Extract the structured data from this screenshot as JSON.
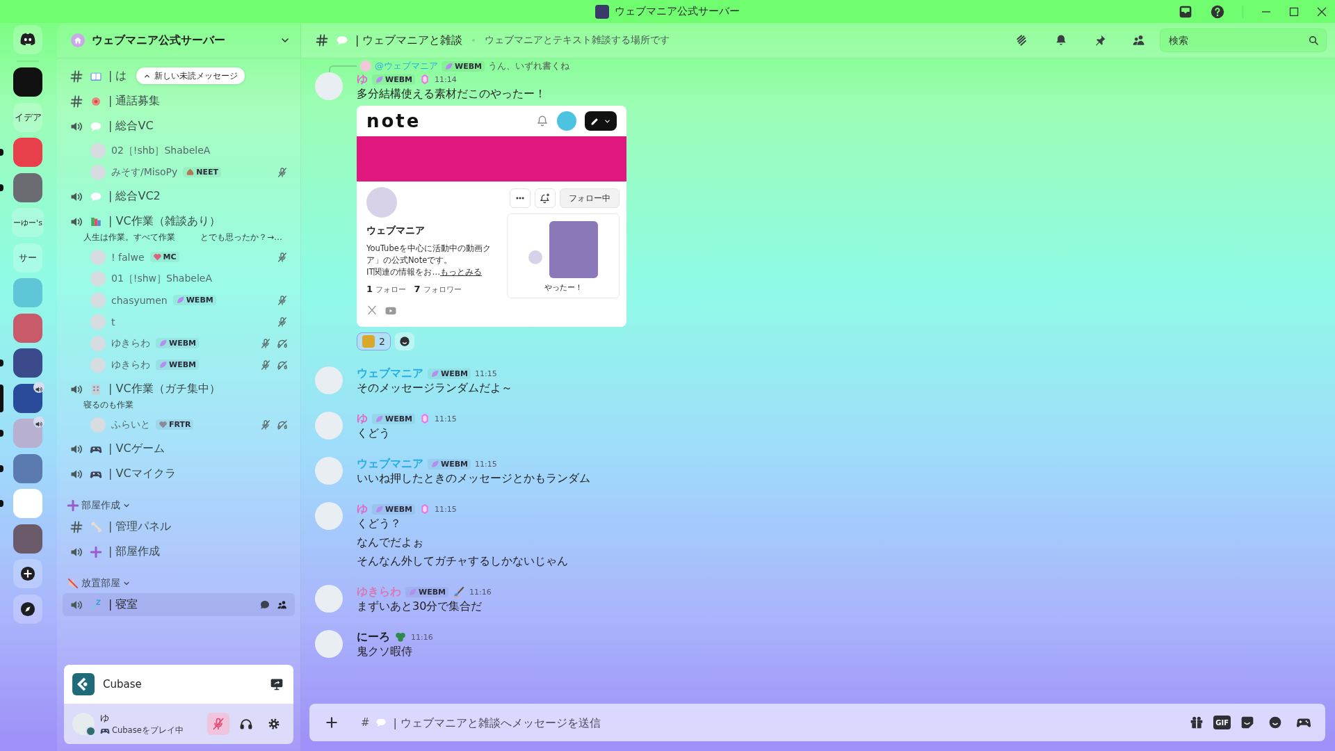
{
  "titlebar": {
    "title": "ウェブマニア公式サーバー"
  },
  "servers": [
    {
      "kind": "home",
      "unread": false,
      "selected": false,
      "in_voice": false
    },
    {
      "kind": "image",
      "color": "#111111",
      "unread": false,
      "selected": false,
      "in_voice": false
    },
    {
      "kind": "text",
      "label": "イデア",
      "unread": false,
      "selected": false,
      "in_voice": false
    },
    {
      "kind": "image",
      "color": "#e8404a",
      "unread": true,
      "selected": false,
      "in_voice": false
    },
    {
      "kind": "image",
      "color": "#6b6b72",
      "unread": true,
      "selected": false,
      "in_voice": false
    },
    {
      "kind": "text",
      "label": "ーゆー's",
      "unread": false,
      "selected": false,
      "in_voice": false
    },
    {
      "kind": "text",
      "label": "サー",
      "unread": false,
      "selected": false,
      "in_voice": false
    },
    {
      "kind": "image",
      "color": "#5fc6d8",
      "unread": false,
      "selected": false,
      "in_voice": false
    },
    {
      "kind": "image",
      "color": "#c85a6a",
      "unread": false,
      "selected": false,
      "in_voice": false
    },
    {
      "kind": "image",
      "color": "#3b4a8a",
      "unread": true,
      "selected": false,
      "in_voice": false
    },
    {
      "kind": "image",
      "color": "#2a4a9a",
      "unread": false,
      "selected": true,
      "in_voice": true
    },
    {
      "kind": "image",
      "color": "#b8b0d0",
      "unread": true,
      "selected": false,
      "in_voice": true
    },
    {
      "kind": "image",
      "color": "#5a7ab0",
      "unread": true,
      "selected": false,
      "in_voice": false
    },
    {
      "kind": "image",
      "color": "#ffffff",
      "unread": true,
      "selected": false,
      "in_voice": false
    },
    {
      "kind": "image",
      "color": "#6a5a6a",
      "unread": false,
      "selected": false,
      "in_voice": false
    },
    {
      "kind": "add",
      "unread": false,
      "selected": false,
      "in_voice": false
    },
    {
      "kind": "discover",
      "unread": false,
      "selected": false,
      "in_voice": false
    }
  ],
  "server": {
    "name": "ウェブマニア公式サーバー"
  },
  "unread_banner": "新しい未読メッセージ",
  "channels": [
    {
      "kind": "text",
      "name": "| は",
      "selected": false
    },
    {
      "kind": "text",
      "name": "| 通話募集",
      "selected": false
    },
    {
      "kind": "voice",
      "name": "| 総合VC",
      "selected": false,
      "members": [
        {
          "name": "02［!shb］ShabeleA",
          "muted": false,
          "deafened": false
        },
        {
          "name": "みそす/MisoPy",
          "tag": {
            "kind": "blob",
            "text": "NEET",
            "color": "#b07a5a"
          },
          "muted": true,
          "deafened": false
        }
      ]
    },
    {
      "kind": "voice",
      "name": "| 総合VC2",
      "selected": false
    },
    {
      "kind": "voice",
      "name": "| VC作業（雑談あり）",
      "selected": false,
      "topic": "人生は作業。すべて作業　　　とでも思ったか？→…",
      "members": [
        {
          "name": "! falwe",
          "tag": {
            "kind": "heart",
            "text": "MC",
            "color": "#e0607a"
          },
          "muted": true,
          "deafened": false
        },
        {
          "name": "01［!shw］ShabeleA",
          "muted": false,
          "deafened": false
        },
        {
          "name": "chasyumen",
          "tag": {
            "kind": "leaf",
            "text": "WEBM",
            "color": "#b58cf0"
          },
          "muted": true,
          "deafened": false
        },
        {
          "name": "t",
          "muted": true,
          "deafened": false
        },
        {
          "name": "ゆきらわ",
          "tag": {
            "kind": "leaf",
            "text": "WEBM",
            "color": "#b58cf0"
          },
          "muted": true,
          "deafened": true
        },
        {
          "name": "ゆきらわ",
          "tag": {
            "kind": "leaf",
            "text": "WEBM",
            "color": "#b58cf0"
          },
          "muted": true,
          "deafened": true
        }
      ]
    },
    {
      "kind": "voice",
      "name": "| VC作業（ガチ集中）",
      "selected": false,
      "topic": "寝るのも作業",
      "members": [
        {
          "name": "ふらいと",
          "tag": {
            "kind": "heart",
            "text": "FRTR",
            "color": "#8a8a96"
          },
          "muted": true,
          "deafened": true
        }
      ]
    },
    {
      "kind": "voice",
      "name": "| VCゲーム",
      "selected": false
    },
    {
      "kind": "voice",
      "name": "| VCマイクラ",
      "selected": false
    },
    {
      "kind": "category",
      "name": "部屋作成",
      "selected": false
    },
    {
      "kind": "text",
      "name": "| 管理パネル",
      "selected": false
    },
    {
      "kind": "voice",
      "name": "| 部屋作成",
      "selected": false
    },
    {
      "kind": "category",
      "name": "放置部屋",
      "selected": false
    },
    {
      "kind": "voice",
      "name": "| 寝室",
      "selected": true
    }
  ],
  "activity": {
    "name": "Cubase"
  },
  "user": {
    "name": "ゆ",
    "status": "Cubaseをプレイ中",
    "muted": true,
    "deafened": false
  },
  "header": {
    "channel": "| ウェブマニアと雑談",
    "topic": "ウェブマニアとテキスト雑談する場所です",
    "search_placeholder": "検索"
  },
  "messages": [
    {
      "author": "ゆ",
      "color": "#e06ac8",
      "tag": {
        "kind": "leaf",
        "text": "WEBM",
        "color": "#b58cf0"
      },
      "time": "11:14",
      "reply": {
        "author": "@ウェブマニア",
        "tag": {
          "kind": "leaf",
          "text": "WEBM",
          "color": "#b58cf0"
        },
        "text": "うん、いずれ書くね"
      },
      "lines": [
        "多分結構使える素材だこのやったー！"
      ],
      "embed": {
        "logo": "note",
        "profile_name": "ウェブマニア",
        "bio": [
          "YouTubeを中心に活動中の動画ク",
          "ア」の公式Noteです。",
          "IT関連の情報をお…"
        ],
        "more_link": "もっとみる",
        "follow_count": "1",
        "follow_label": "フォロー",
        "follower_count": "7",
        "follower_label": "フォロワー",
        "follow_button": "フォロー中",
        "popup_caption": "やったー！"
      },
      "reactions": [
        {
          "count": "2",
          "selected": true
        }
      ]
    },
    {
      "author": "ウェブマニア",
      "color": "#27aee0",
      "tag": {
        "kind": "leaf",
        "text": "WEBM",
        "color": "#b58cf0"
      },
      "time": "11:15",
      "lines": [
        "そのメッセージランダムだよ～"
      ]
    },
    {
      "author": "ゆ",
      "color": "#e06ac8",
      "tag": {
        "kind": "leaf",
        "text": "WEBM",
        "color": "#b58cf0"
      },
      "time": "11:15",
      "lines": [
        "くどう"
      ]
    },
    {
      "author": "ウェブマニア",
      "color": "#27aee0",
      "tag": {
        "kind": "leaf",
        "text": "WEBM",
        "color": "#b58cf0"
      },
      "time": "11:15",
      "lines": [
        "いいね押したときのメッセージとかもランダム"
      ]
    },
    {
      "author": "ゆ",
      "color": "#e06ac8",
      "tag": {
        "kind": "leaf",
        "text": "WEBM",
        "color": "#b58cf0"
      },
      "time": "11:15",
      "lines": [
        "くどう？",
        "なんでだよぉ",
        "そんなん外してガチャするしかないじゃん"
      ]
    },
    {
      "author": "ゆきらわ",
      "color": "#d77ab4",
      "tag": {
        "kind": "leaf",
        "text": "WEBM",
        "color": "#b58cf0"
      },
      "time": "11:16",
      "lines": [
        "まずいあと30分で集合だ"
      ]
    },
    {
      "author": "にーろ",
      "color": "#1e2124",
      "time": "11:16",
      "lines": [
        "鬼クソ暇侍"
      ]
    }
  ],
  "composer": {
    "prefix": "#",
    "placeholder": "| ウェブマニアと雑談へメッセージを送信",
    "gif_label": "GIF"
  }
}
